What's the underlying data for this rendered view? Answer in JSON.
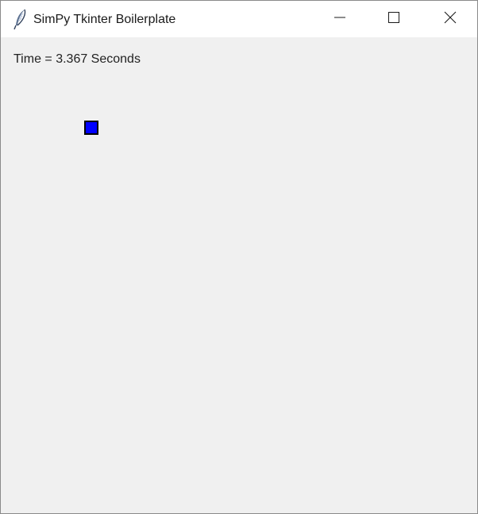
{
  "window": {
    "title": "SimPy Tkinter Boilerplate",
    "app_icon": "feather-icon",
    "controls": {
      "minimize_icon": "minimize-icon",
      "maximize_icon": "maximize-icon",
      "close_icon": "close-icon"
    }
  },
  "main": {
    "time_text": "Time = 3.367 Seconds",
    "entity": {
      "shape": "square",
      "fill_color": "#0000ff",
      "outline_color": "#000000"
    }
  },
  "colors": {
    "titlebar_bg": "#ffffff",
    "client_bg": "#f0f0f0"
  }
}
